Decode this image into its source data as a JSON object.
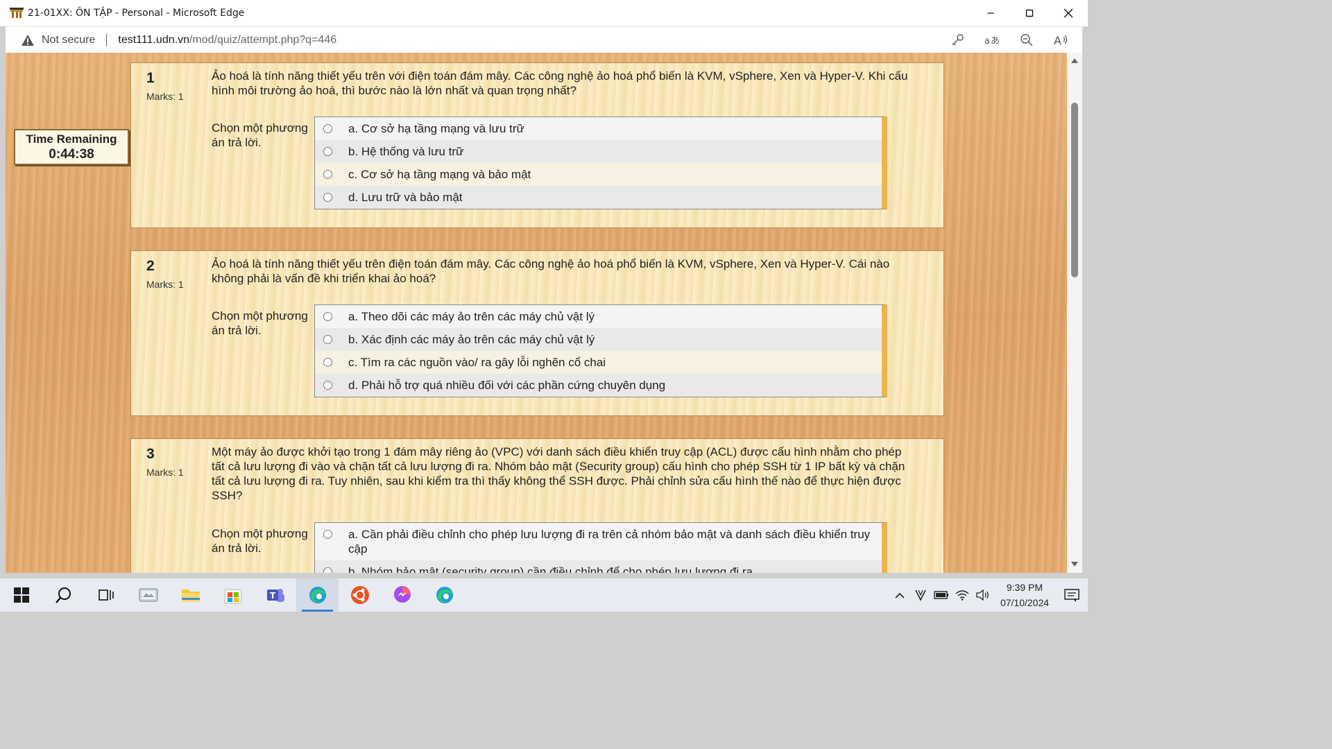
{
  "window": {
    "title": "21-01XX: ÔN TẬP - Personal - Microsoft Edge"
  },
  "address": {
    "security_label": "Not secure",
    "url_host": "test111.udn.vn",
    "url_path": "/mod/quiz/attempt.php?q=446"
  },
  "toolbar_icons": [
    "key-icon",
    "translate-icon",
    "zoom-out-icon",
    "read-aloud-icon"
  ],
  "timer": {
    "label": "Time Remaining",
    "value": "0:44:38"
  },
  "questions": [
    {
      "number": "1",
      "marks": "Marks: 1",
      "text": "Ảo hoá là tính năng thiết yếu trên với điện toán đám mây. Các công nghệ ảo hoá phổ biến là KVM, vSphere, Xen và Hyper-V. Khi cấu hình môi trường ảo hoá, thì bước nào là lớn nhất và quan trọng nhất?",
      "prompt": "Chọn một phương án trả lời.",
      "options": [
        "a. Cơ sở hạ tầng mạng và lưu trữ",
        "b. Hệ thống và lưu trữ",
        "c. Cơ sở hạ tầng mạng và bảo mật",
        "d. Lưu trữ và bảo mật"
      ]
    },
    {
      "number": "2",
      "marks": "Marks: 1",
      "text": "Ảo hoá là tính năng thiết yếu trên điện toán đám mây. Các công nghệ ảo hoá phổ biến là KVM, vSphere, Xen và Hyper-V. Cái nào không phải là vấn đề khi triển khai ảo hoá?",
      "prompt": "Chọn một phương án trả lời.",
      "options": [
        "a. Theo dõi các máy ảo trên các máy chủ vật lý",
        "b. Xác định các máy ảo trên các máy chủ vật lý",
        "c. Tìm ra các nguồn vào/ ra gây lỗi nghẽn cổ chai",
        "d. Phải hỗ trợ quá nhiều đối với các phần cứng chuyên dụng"
      ]
    },
    {
      "number": "3",
      "marks": "Marks: 1",
      "text": "Một máy ảo được khởi tạo trong 1 đám mây riêng ảo (VPC) với danh sách điều khiển truy cập (ACL) được cấu hình nhằm cho phép tất cả lưu lượng đi vào và chặn tất cả lưu lượng đi ra. Nhóm bảo mật (Security group) cấu hình cho phép SSH từ 1 IP bất kỳ và chặn tất cả lưu lượng đi ra. Tuy nhiên, sau khi kiểm tra thì thấy không thể SSH được. Phải chỉnh sửa cấu hình thế nào để thực hiện được SSH?",
      "prompt": "Chọn một phương án trả lời.",
      "options": [
        "a. Cần phải điều chỉnh cho phép lưu lượng đi ra trên cả nhóm bảo mật và danh sách điều khiển truy cập",
        "b. Nhóm bảo mật (security group) cần điều chỉnh để cho phép lưu lượng đi ra"
      ]
    }
  ],
  "taskbar": {
    "apps": [
      "windows-start-icon",
      "search-icon",
      "task-view-icon",
      "app-icon",
      "file-explorer-icon",
      "microsoft-store-icon",
      "teams-icon",
      "edge-icon",
      "ubuntu-icon",
      "messenger-icon",
      "edge-icon"
    ],
    "time": "9:39 PM",
    "date": "07/10/2024"
  }
}
